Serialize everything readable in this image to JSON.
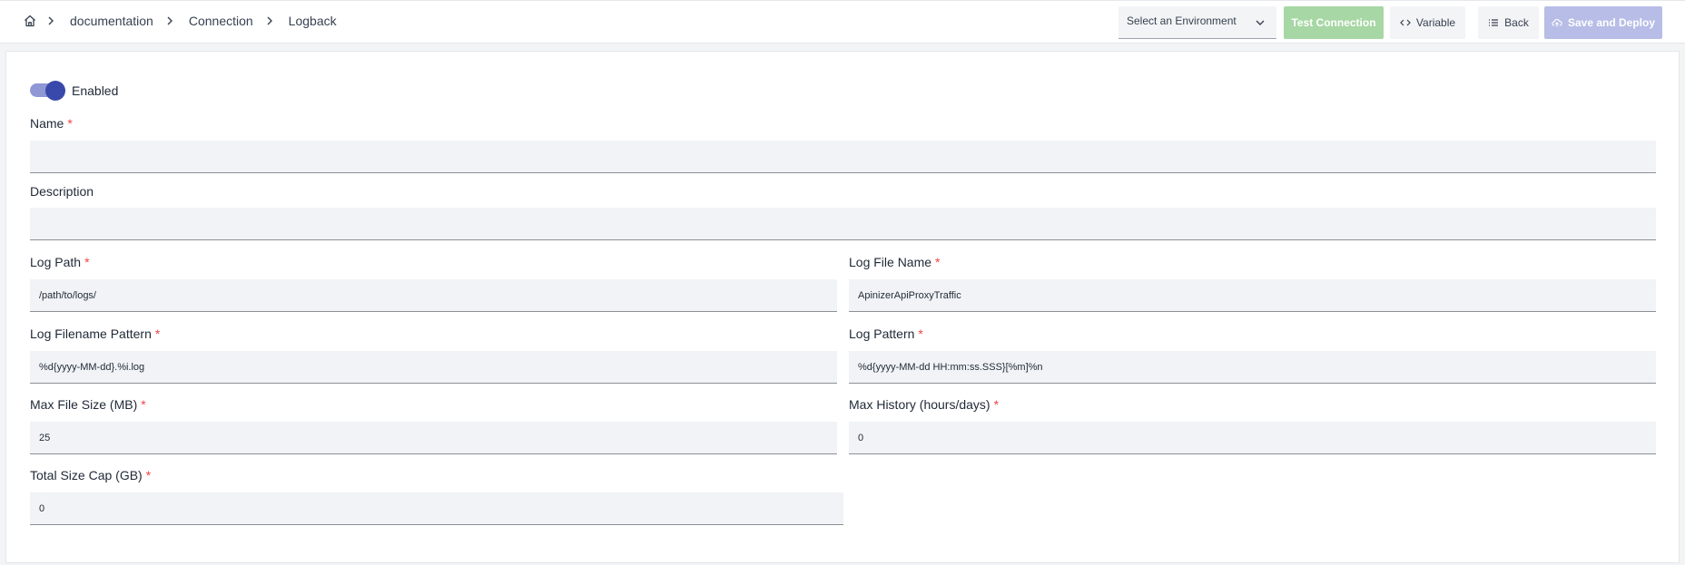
{
  "breadcrumb": {
    "home_icon": "home-icon",
    "items": [
      "documentation",
      "Connection",
      "Logback"
    ]
  },
  "toolbar": {
    "environment_placeholder": "Select an Environment",
    "test_label": "Test Connection",
    "variable_label": "Variable",
    "back_label": "Back",
    "save_label": "Save and Deploy"
  },
  "form": {
    "enabled_label": "Enabled",
    "enabled": true,
    "required_mark": "*",
    "name": {
      "label": "Name",
      "value": ""
    },
    "description": {
      "label": "Description",
      "value": ""
    },
    "log_path": {
      "label": "Log Path",
      "value": "/path/to/logs/"
    },
    "log_file_name": {
      "label": "Log File Name",
      "value": "ApinizerApiProxyTraffic"
    },
    "log_filename_pattern": {
      "label": "Log Filename Pattern",
      "value": "%d{yyyy-MM-dd}.%i.log"
    },
    "log_pattern": {
      "label": "Log Pattern",
      "value": "%d{yyyy-MM-dd HH:mm:ss.SSS}[%m]%n"
    },
    "max_file_size": {
      "label": "Max File Size (MB)",
      "value": "25"
    },
    "max_history": {
      "label": "Max History (hours/days)",
      "value": "0"
    },
    "total_size_cap": {
      "label": "Total Size Cap (GB)",
      "value": "0"
    }
  },
  "colors": {
    "primary": "#3949ab",
    "success_disabled": "#a7d7a4",
    "primary_disabled": "#b7bde6",
    "required": "#ef4444"
  }
}
